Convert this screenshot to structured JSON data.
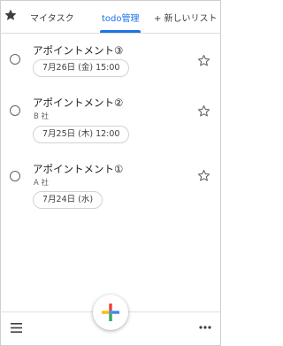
{
  "tabs": [
    {
      "label": "マイタスク",
      "active": false
    },
    {
      "label": "todo管理",
      "active": true
    },
    {
      "label": "+ 新しいリスト",
      "active": false
    }
  ],
  "tasks": [
    {
      "title": "アポイントメント③",
      "note": "",
      "date": "7月26日 (金) 15:00"
    },
    {
      "title": "アポイントメント②",
      "note": "B 社",
      "date": "7月25日 (木) 12:00"
    },
    {
      "title": "アポイントメント①",
      "note": "A 社",
      "date": "7月24日 (水)"
    }
  ],
  "icons": {
    "starred": "star-filled-icon",
    "task_star": "star-outline-icon",
    "menu": "menu-icon",
    "more": "more-icon",
    "add": "plus-icon"
  },
  "colors": {
    "accent": "#1a73e8",
    "google_blue": "#4285f4",
    "google_red": "#ea4335",
    "google_yellow": "#fbbc04",
    "google_green": "#34a853"
  }
}
